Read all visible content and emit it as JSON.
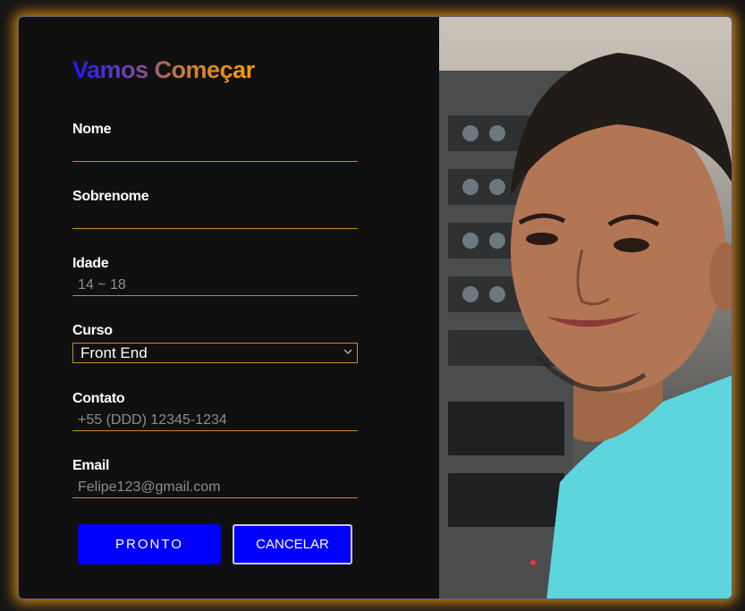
{
  "form": {
    "title": "Vamos Começar",
    "fields": [
      {
        "label": "Nome",
        "value": "",
        "placeholder": ""
      },
      {
        "label": "Sobrenome",
        "value": "",
        "placeholder": ""
      },
      {
        "label": "Idade",
        "value": "",
        "placeholder": "14 ~ 18"
      },
      {
        "label": "Curso",
        "selected": "Front End"
      },
      {
        "label": "Contato",
        "value": "",
        "placeholder": "+55 (DDD) 12345-1234"
      },
      {
        "label": "Email",
        "value": "",
        "placeholder": "Felipe123@gmail.com"
      }
    ],
    "buttons": {
      "submit_label": "PRONTO",
      "cancel_label": "CANCELAR"
    }
  },
  "photo": {
    "icon": "person-photo"
  },
  "colors": {
    "accent_orange": "#ff9d00",
    "button_blue": "#0000ff",
    "card_bg": "#101010",
    "title_gradient_start": "#1a1aff"
  }
}
